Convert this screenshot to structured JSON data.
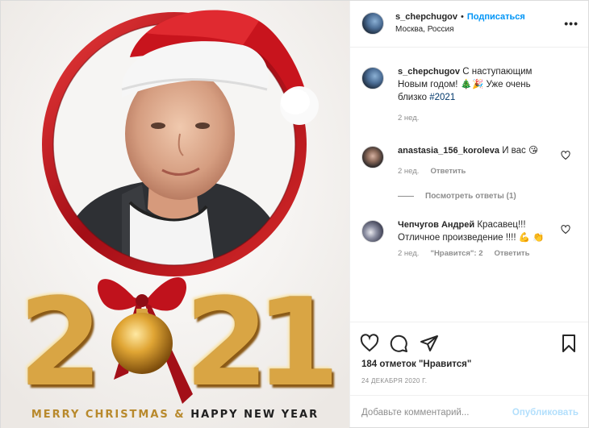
{
  "post": {
    "author": {
      "username": "s_chepchugov",
      "follow_label": "Подписаться",
      "location": "Москва, Россия"
    },
    "more_label": "•••",
    "image": {
      "year_digits": [
        "2",
        "0",
        "2",
        "1"
      ],
      "greeting_part1": "MERRY CHRISTMAS & ",
      "greeting_part2": "HAPPY NEW YEAR",
      "colors": {
        "ring": "#c3121e",
        "gold": "#d9a544",
        "ribbon": "#c0121c"
      }
    },
    "caption": {
      "username": "s_chepchugov",
      "text": "С наступающим Новым годом! 🎄🎉 Уже очень близко",
      "hashtag": "#2021",
      "time": "2 нед."
    },
    "comments": [
      {
        "username": "anastasia_156_koroleva",
        "text": "И вас 😘",
        "time": "2 нед.",
        "reply_label": "Ответить",
        "view_replies": "Посмотреть ответы (1)"
      },
      {
        "username": "Чепчугов Андрей",
        "text": "Красавец!!! Отличное произведение !!!! 💪 👏",
        "time": "2 нед.",
        "likes_label": "\"Нравится\": 2",
        "reply_label": "Ответить"
      }
    ],
    "likes": "184 отметок \"Нравится\"",
    "date": "24 ДЕКАБРЯ 2020 Г.",
    "add_comment_placeholder": "Добавьте комментарий...",
    "publish_label": "Опубликовать"
  }
}
